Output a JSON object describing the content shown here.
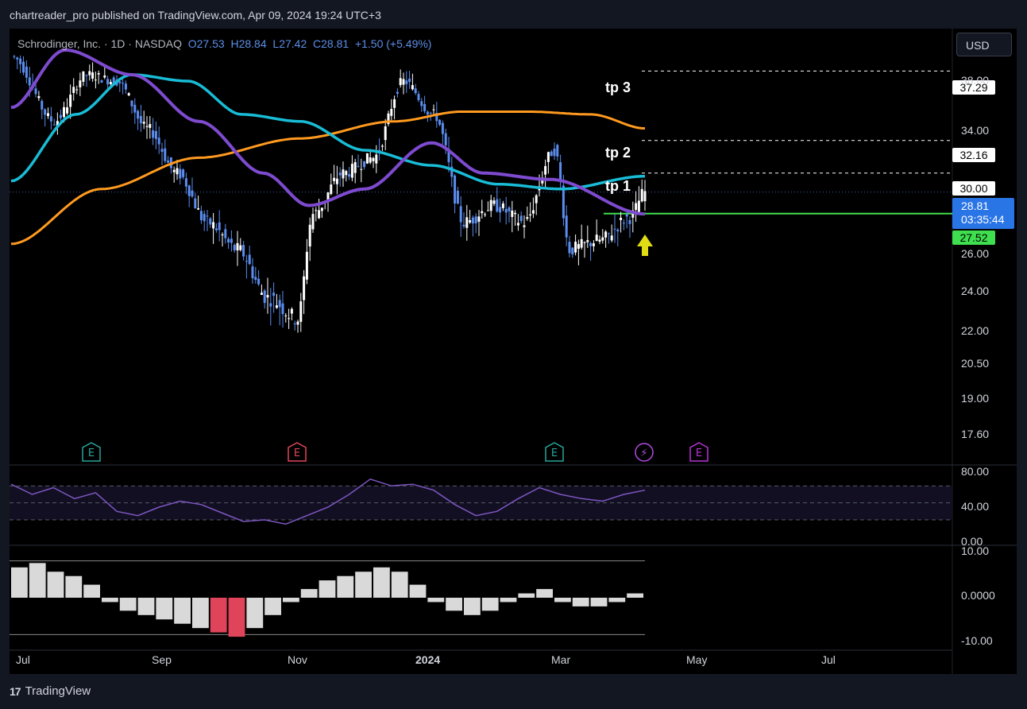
{
  "publisher_line": "chartreader_pro published on TradingView.com, Apr 09, 2024 19:24 UTC+3",
  "footer_brand": "TradingView",
  "footer_mark": "17",
  "currency_button": "USD",
  "legend": {
    "symbol": "Schrodinger, Inc. · 1D · NASDAQ",
    "open": "O27.53",
    "high": "H28.84",
    "low": "L27.42",
    "close": "C28.81",
    "change": "+1.50 (+5.49%)"
  },
  "targets": [
    {
      "label": "tp 3",
      "price": "37.29"
    },
    {
      "label": "tp 2",
      "price": "32.16"
    },
    {
      "label": "tp 1",
      "price": "30.00"
    }
  ],
  "current_price": {
    "price": "28.81",
    "countdown": "03:35:44"
  },
  "support_price": "27.52",
  "colors": {
    "background": "#000000",
    "up_candle": "#ffffff",
    "down_candle": "#5b8def",
    "ema_cyan": "#19bcd6",
    "ema_orange": "#ff9a1f",
    "ma_purple": "#7e4bd0",
    "support_line": "#3fe04f",
    "current_price": "#2a75e6",
    "rsi_line": "#7e57c2"
  },
  "events": [
    {
      "type": "earnings",
      "icon": "E",
      "color": "#26a69a"
    },
    {
      "type": "earnings",
      "icon": "E",
      "color": "#e0445a"
    },
    {
      "type": "earnings",
      "icon": "E",
      "color": "#26a69a"
    },
    {
      "type": "split-dividend",
      "icon": "⚡",
      "color": "#b24be0"
    },
    {
      "type": "earnings",
      "icon": "E",
      "color": "#b833d6"
    }
  ],
  "chart_data": [
    {
      "type": "candlestick",
      "title": "Schrodinger, Inc. · 1D · NASDAQ",
      "x_ticks": [
        "Jul",
        "Sep",
        "Nov",
        "2024",
        "Mar",
        "May",
        "Jul"
      ],
      "y_ticks": [
        "38.00",
        "34.00",
        "26.00",
        "24.00",
        "22.00",
        "20.50",
        "19.00",
        "17.60"
      ],
      "y_scale": "log",
      "ylim": [
        16.8,
        40.0
      ],
      "price_series": [
        {
          "date": "2023-06-20",
          "close": 38.5
        },
        {
          "date": "2023-07-10",
          "close": 33.5
        },
        {
          "date": "2023-07-25",
          "close": 37.0
        },
        {
          "date": "2023-08-08",
          "close": 36.5
        },
        {
          "date": "2023-08-22",
          "close": 33.0
        },
        {
          "date": "2023-09-05",
          "close": 30.0
        },
        {
          "date": "2023-09-19",
          "close": 27.0
        },
        {
          "date": "2023-10-03",
          "close": 25.5
        },
        {
          "date": "2023-10-17",
          "close": 23.0
        },
        {
          "date": "2023-10-31",
          "close": 22.0
        },
        {
          "date": "2023-11-07",
          "close": 27.5
        },
        {
          "date": "2023-11-21",
          "close": 30.0
        },
        {
          "date": "2023-12-05",
          "close": 31.0
        },
        {
          "date": "2023-12-19",
          "close": 36.5
        },
        {
          "date": "2024-01-02",
          "close": 34.0
        },
        {
          "date": "2024-01-16",
          "close": 27.0
        },
        {
          "date": "2024-01-30",
          "close": 28.0
        },
        {
          "date": "2024-02-13",
          "close": 27.0
        },
        {
          "date": "2024-02-27",
          "close": 31.5
        },
        {
          "date": "2024-03-05",
          "close": 25.5
        },
        {
          "date": "2024-03-19",
          "close": 26.0
        },
        {
          "date": "2024-04-02",
          "close": 27.3
        },
        {
          "date": "2024-04-09",
          "close": 28.81
        }
      ],
      "ema_cyan": [
        {
          "date": "2023-06-20",
          "value": 29.5
        },
        {
          "date": "2023-07-20",
          "value": 34.0
        },
        {
          "date": "2023-08-15",
          "value": 37.0
        },
        {
          "date": "2023-09-10",
          "value": 36.5
        },
        {
          "date": "2023-10-05",
          "value": 34.0
        },
        {
          "date": "2023-11-01",
          "value": 33.5
        },
        {
          "date": "2023-12-01",
          "value": 31.5
        },
        {
          "date": "2024-01-01",
          "value": 30.5
        },
        {
          "date": "2024-02-01",
          "value": 29.3
        },
        {
          "date": "2024-03-01",
          "value": 29.0
        },
        {
          "date": "2024-04-09",
          "value": 29.8
        }
      ],
      "ema_orange": [
        {
          "date": "2023-06-20",
          "value": 25.8
        },
        {
          "date": "2023-08-01",
          "value": 29.0
        },
        {
          "date": "2023-09-15",
          "value": 31.0
        },
        {
          "date": "2023-11-01",
          "value": 32.3
        },
        {
          "date": "2023-12-15",
          "value": 33.5
        },
        {
          "date": "2024-01-15",
          "value": 34.2
        },
        {
          "date": "2024-02-15",
          "value": 34.2
        },
        {
          "date": "2024-03-15",
          "value": 34.0
        },
        {
          "date": "2024-04-09",
          "value": 33.0
        }
      ],
      "ma_purple": [
        {
          "date": "2023-06-20",
          "value": 34.5
        },
        {
          "date": "2023-07-15",
          "value": 39.0
        },
        {
          "date": "2023-08-15",
          "value": 37.0
        },
        {
          "date": "2023-09-15",
          "value": 33.5
        },
        {
          "date": "2023-10-15",
          "value": 30.0
        },
        {
          "date": "2023-11-05",
          "value": 28.0
        },
        {
          "date": "2023-12-01",
          "value": 29.0
        },
        {
          "date": "2024-01-01",
          "value": 32.0
        },
        {
          "date": "2024-01-25",
          "value": 30.0
        },
        {
          "date": "2024-02-25",
          "value": 29.6
        },
        {
          "date": "2024-04-09",
          "value": 27.5
        }
      ],
      "target_levels": [
        37.29,
        32.16,
        30.0
      ],
      "support_level": 27.52,
      "current": 28.81
    },
    {
      "type": "line",
      "title": "",
      "y_ticks": [
        "80.00",
        "40.00",
        "0.00"
      ],
      "ylim": [
        0,
        90
      ],
      "bands": [
        70,
        50,
        30
      ],
      "series": [
        {
          "values": [
            72,
            60,
            68,
            55,
            62,
            40,
            35,
            45,
            52,
            48,
            38,
            28,
            30,
            25,
            35,
            45,
            60,
            78,
            70,
            72,
            65,
            48,
            35,
            40,
            55,
            68,
            60,
            55,
            52,
            60,
            65
          ]
        }
      ]
    },
    {
      "type": "bar",
      "title": "",
      "y_ticks": [
        "10.00",
        "0.0000",
        "-10.00"
      ],
      "ylim": [
        -11,
        11
      ],
      "values": [
        7,
        8,
        6,
        5,
        3,
        -1,
        -3,
        -4,
        -5,
        -6,
        -7,
        -8,
        -9,
        -7,
        -4,
        -1,
        2,
        4,
        5,
        6,
        7,
        6,
        3,
        -1,
        -3,
        -4,
        -3,
        -1,
        1,
        2,
        -1,
        -2,
        -2,
        -1,
        1
      ]
    }
  ]
}
